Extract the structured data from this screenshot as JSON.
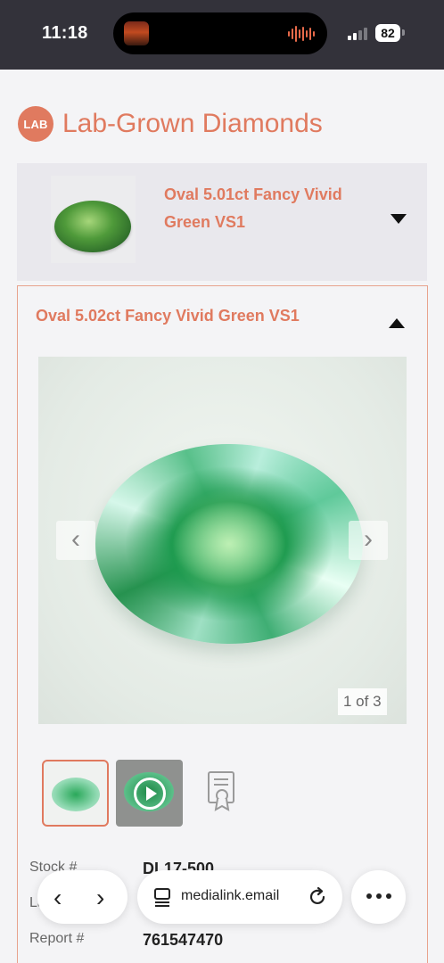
{
  "status_bar": {
    "time": "11:18",
    "battery_level": "82",
    "signal_bars_filled": 2,
    "signal_bars_total": 4
  },
  "brand": {
    "logo_text": "LAB",
    "title": "Lab-Grown Diamonds",
    "accent_color": "#e07a5f"
  },
  "collapsed_item": {
    "title": "Oval 5.01ct Fancy Vivid Green VS1",
    "thumb_icon": "green-oval-diamond-icon",
    "toggle_icon": "caret-down-icon"
  },
  "expanded_item": {
    "title": "Oval 5.02ct Fancy Vivid Green VS1",
    "toggle_icon": "caret-up-icon",
    "gallery": {
      "prev_glyph": "‹",
      "next_glyph": "›",
      "counter": "1 of 3",
      "thumbnails": [
        {
          "kind": "image",
          "icon": "diamond-thumbnail-icon",
          "selected": true
        },
        {
          "kind": "video",
          "icon": "play-icon",
          "selected": false
        },
        {
          "kind": "certificate",
          "icon": "certificate-icon",
          "selected": false
        }
      ]
    },
    "specs": [
      {
        "label": "Stock #",
        "value": "DL17-500"
      },
      {
        "label": "La",
        "value": ""
      },
      {
        "label": "Report #",
        "value": "761547470"
      }
    ]
  },
  "browser_bar": {
    "back_glyph": "‹",
    "forward_glyph": "›",
    "url": "medialink.email",
    "reader_icon": "reader-icon",
    "reload_icon": "reload-icon",
    "more_icon": "more-icon"
  }
}
